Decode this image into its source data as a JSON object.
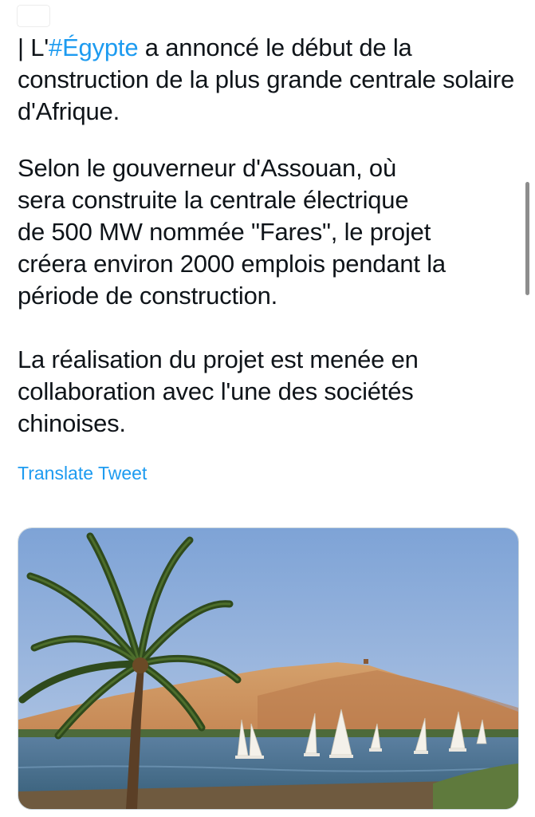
{
  "tweet": {
    "text_first_line_rest": "| L'",
    "hashtag": "#Égypte",
    "first_paragraph_tail": " a annoncé le début de la\nconstruction de la plus grande centrale\nsolaire d'Afrique.",
    "paragraph_2": "Selon le gouverneur d'Assouan, où\nsera construite la centrale électrique\nde 500 MW nommée \"Fares\", le projet\ncréera environ 2000 emplois pendant la\npériode de construction.",
    "paragraph_3": "La réalisation du projet est menée en\ncollaboration avec l'une des sociétés\nchinoises."
  },
  "translate_label": "Translate Tweet",
  "colors": {
    "link": "#1d9bf0",
    "text": "#0f1419",
    "scrollbar": "#8d8d8d"
  },
  "icons": {
    "flag": "egypt-flag-icon"
  }
}
